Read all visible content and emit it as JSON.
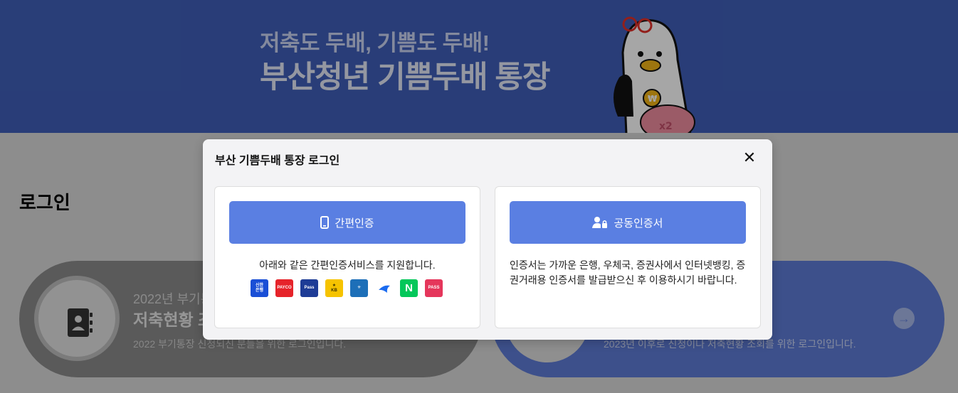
{
  "hero": {
    "subtitle": "저축도 두배, 기쁨도 두배!",
    "title": "부산청년 기쁨두배 통장",
    "mascot_coin": "₩",
    "mascot_pig": "x2"
  },
  "page": {
    "title": "로그인"
  },
  "cards": [
    {
      "year": "2022년 부기통장",
      "heading": "저축현황 조회",
      "description": "2022 부기통장 신청되신 분들을 위한 로그인입니다.",
      "color": "#555555"
    },
    {
      "description": "2023년 이후로 신청이나 저축현황 조회를 위한 로그인입니다.",
      "arrow": "→",
      "color": "#3b5fd0"
    }
  ],
  "modal": {
    "title": "부산 기쁨두배 통장 로그인",
    "close": "✕",
    "simple_auth": {
      "label": "간편인증",
      "description": "아래와 같은 간편인증서비스를 지원합니다.",
      "providers": [
        {
          "name": "신한은행",
          "color": "#1a4fd6"
        },
        {
          "name": "PAYCO",
          "color": "#e6232a"
        },
        {
          "name": "삼성패스 Pass",
          "color": "#1e3c96"
        },
        {
          "name": "KB국민은행",
          "color": "#f6c300"
        },
        {
          "name": "행정안전부",
          "color": "#1d6fb8"
        },
        {
          "name": "토스",
          "color": "#ffffff"
        },
        {
          "name": "N",
          "color": "#03c75a"
        },
        {
          "name": "PASS",
          "color": "#e5365b"
        }
      ]
    },
    "cert_auth": {
      "label": "공동인증서",
      "description": "인증서는 가까운 은행, 우체국, 증권사에서 인터넷뱅킹, 증권거래용 인증서를 발급받으신 후 이용하시기 바랍니다."
    },
    "accent": "#5a7fe2"
  }
}
